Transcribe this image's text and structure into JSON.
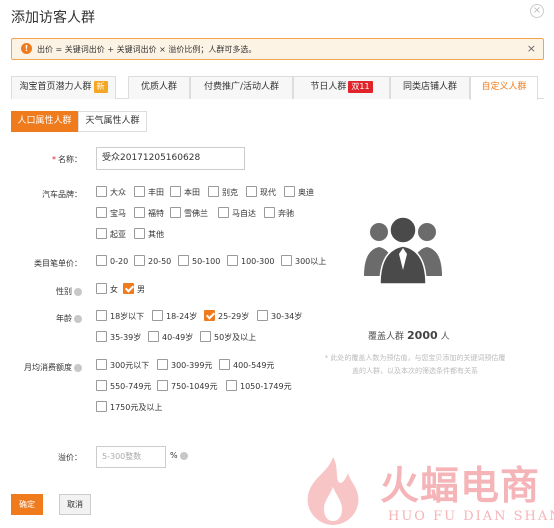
{
  "dialog": {
    "title": "添加访客人群",
    "close_icon": "close-circle-icon"
  },
  "notice": {
    "text": "出价 = 关键词出价 + 关键词出价 × 溢价比例；人群可多选。",
    "icon": "exclamation-icon",
    "close": "×"
  },
  "tabs": [
    {
      "label": "淘宝首页潜力人群",
      "badge": "新"
    },
    {
      "label": "优质人群"
    },
    {
      "label": "付费推广/活动人群"
    },
    {
      "label": "节日人群",
      "badge": "双11"
    },
    {
      "label": "同类店铺人群"
    },
    {
      "label": "自定义人群"
    }
  ],
  "subtabs": [
    "人口属性人群",
    "天气属性人群"
  ],
  "form": {
    "name": {
      "label": "名称：",
      "required": "*",
      "value": "受众20171205160628"
    },
    "car_brand": {
      "label": "汽车品牌：",
      "options": [
        "大众",
        "丰田",
        "本田",
        "别克",
        "现代",
        "奥迪",
        "宝马",
        "福特",
        "雪佛兰",
        "马自达",
        "奔驰",
        "起亚",
        "其他"
      ]
    },
    "unit_price": {
      "label": "类目笔单价：",
      "options": [
        "0-20",
        "20-50",
        "50-100",
        "100-300",
        "300以上"
      ]
    },
    "gender": {
      "label": "性别",
      "options": [
        "女",
        "男"
      ],
      "checked": [
        "男"
      ]
    },
    "age": {
      "label": "年龄",
      "options": [
        "18岁以下",
        "18-24岁",
        "25-29岁",
        "30-34岁",
        "35-39岁",
        "40-49岁",
        "50岁及以上"
      ],
      "checked": [
        "25-29岁"
      ]
    },
    "monthly_spend": {
      "label": "月均消费额度",
      "options": [
        "300元以下",
        "300-399元",
        "400-549元",
        "550-749元",
        "750-1049元",
        "1050-1749元",
        "1750元及以上"
      ]
    },
    "premium": {
      "label": "溢价：",
      "placeholder": "5-300整数",
      "unit": "%"
    }
  },
  "coverage": {
    "prefix": "覆盖人群",
    "count": "2000",
    "suffix": "人",
    "note": "* 此处的覆盖人数为预估值，与您宝贝添加的关键词预估覆盖的人群，以及本次的筛选条件都有关系",
    "icon": "people-group-icon"
  },
  "buttons": {
    "ok": "确定",
    "cancel": "取消"
  },
  "watermark": {
    "cn": "火蝠电商",
    "en": "HUO FU DIAN SHANG",
    "icon": "flame-logo-icon"
  },
  "colors": {
    "accent": "#f07b1d",
    "badge_new": "#f5a623",
    "badge_double11": "#e0242a",
    "notice_bg": "#fdf3e5",
    "notice_border": "#f5a352"
  }
}
